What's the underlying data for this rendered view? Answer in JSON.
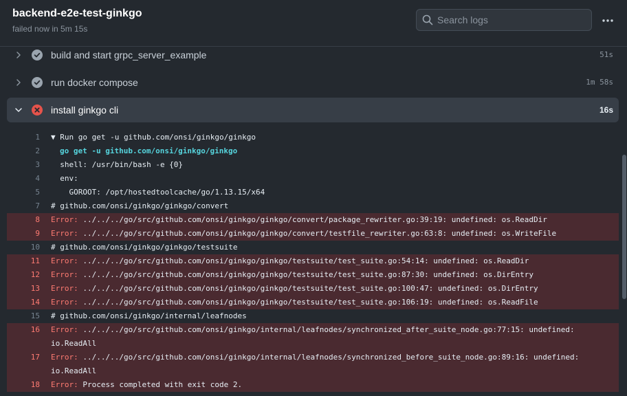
{
  "header": {
    "title": "backend-e2e-test-ginkgo",
    "status": "failed now in 5m 15s",
    "search_placeholder": "Search logs"
  },
  "steps": [
    {
      "name": "build and start grpc_server_example",
      "duration": "51s",
      "state": "success"
    },
    {
      "name": "run docker compose",
      "duration": "1m 58s",
      "state": "success"
    },
    {
      "name": "install ginkgo cli",
      "duration": "16s",
      "state": "failure"
    }
  ],
  "log": [
    {
      "n": "1",
      "t": "▼ Run go get -u github.com/onsi/ginkgo/ginkgo"
    },
    {
      "n": "2",
      "t": "go get -u github.com/onsi/ginkgo/ginkgo"
    },
    {
      "n": "3",
      "t": "  shell: /usr/bin/bash -e {0}"
    },
    {
      "n": "4",
      "t": "  env:"
    },
    {
      "n": "5",
      "t": "    GOROOT: /opt/hostedtoolcache/go/1.13.15/x64"
    },
    {
      "n": "7",
      "t": "# github.com/onsi/ginkgo/ginkgo/convert"
    },
    {
      "n": "8",
      "k": "Error:",
      "t": " ../../../go/src/github.com/onsi/ginkgo/ginkgo/convert/package_rewriter.go:39:19: undefined: os.ReadDir"
    },
    {
      "n": "9",
      "k": "Error:",
      "t": " ../../../go/src/github.com/onsi/ginkgo/ginkgo/convert/testfile_rewriter.go:63:8: undefined: os.WriteFile"
    },
    {
      "n": "10",
      "t": "# github.com/onsi/ginkgo/ginkgo/testsuite"
    },
    {
      "n": "11",
      "k": "Error:",
      "t": " ../../../go/src/github.com/onsi/ginkgo/ginkgo/testsuite/test_suite.go:54:14: undefined: os.ReadDir"
    },
    {
      "n": "12",
      "k": "Error:",
      "t": " ../../../go/src/github.com/onsi/ginkgo/ginkgo/testsuite/test_suite.go:87:30: undefined: os.DirEntry"
    },
    {
      "n": "13",
      "k": "Error:",
      "t": " ../../../go/src/github.com/onsi/ginkgo/ginkgo/testsuite/test_suite.go:100:47: undefined: os.DirEntry"
    },
    {
      "n": "14",
      "k": "Error:",
      "t": " ../../../go/src/github.com/onsi/ginkgo/ginkgo/testsuite/test_suite.go:106:19: undefined: os.ReadFile"
    },
    {
      "n": "15",
      "t": "# github.com/onsi/ginkgo/internal/leafnodes"
    },
    {
      "n": "16",
      "k": "Error:",
      "t": " ../../../go/src/github.com/onsi/ginkgo/internal/leafnodes/synchronized_after_suite_node.go:77:15: undefined:",
      "t2": "io.ReadAll"
    },
    {
      "n": "17",
      "k": "Error:",
      "t": " ../../../go/src/github.com/onsi/ginkgo/internal/leafnodes/synchronized_before_suite_node.go:89:16: undefined:",
      "t2": "io.ReadAll"
    },
    {
      "n": "18",
      "k": "Error:",
      "t": " Process completed with exit code 2."
    }
  ],
  "icons": {
    "success": "check-circle-icon",
    "failure": "x-circle-icon",
    "search": "search-icon",
    "more": "kebab-horizontal-icon"
  },
  "colors": {
    "error_bg": "#4a2a30",
    "error_text": "#ff7b72",
    "command": "#56d4dd",
    "failure_icon": "#e5534b"
  }
}
